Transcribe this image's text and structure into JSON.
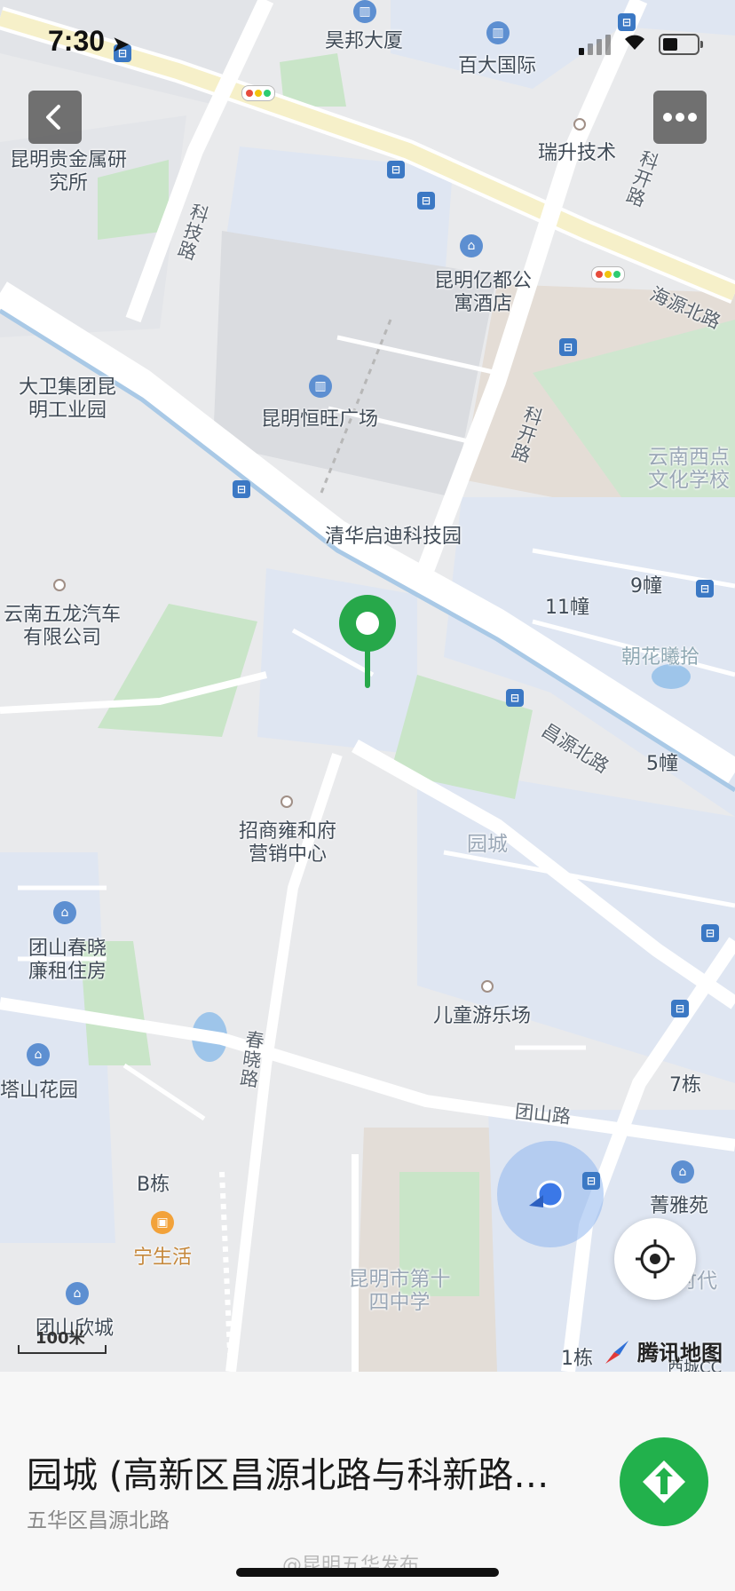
{
  "status_bar": {
    "time": "7:30"
  },
  "map": {
    "labels": {
      "haobang": "昊邦大厦",
      "baida": "百大国际",
      "ruisheng": "瑞升技术",
      "guijinshu": "昆明贵金属研究所",
      "kejilu": "科技路",
      "yidu": "昆明亿都公寓酒店",
      "kekailu_top": "科开路",
      "haiyuanbeilu": "海源北路",
      "dawei": "大卫集团昆明工业园",
      "hengwang": "昆明恒旺广场",
      "kekailu_mid": "科开路",
      "xidian": "云南西点文化学校",
      "qihua": "清华启迪科技园",
      "building9": "9幢",
      "building11": "11幢",
      "chaohua": "朝花曦拾",
      "wulong": "云南五龙汽车有限公司",
      "changyuan": "昌源北路",
      "building5": "5幢",
      "zhaoshang": "招商雍和府营销中心",
      "yuancheng": "园城",
      "tuanshan_lianzu": "团山春晓廉租住房",
      "ertong": "儿童游乐场",
      "tashan": "塔山花园",
      "chunxiaolu": "春晓路",
      "building7": "7栋",
      "tuanshanlu": "团山路",
      "b_building": "B栋",
      "jingya": "菁雅苑",
      "ningshenghuo": "宁生活",
      "no14": "昆明市第十四中学",
      "shidai": "时代",
      "tuanshan_xincheng": "团山欣城",
      "building1": "1栋",
      "xicheng": "西城CC"
    },
    "scale_label": "100米",
    "brand": "腾讯地图"
  },
  "panel": {
    "title": "园城 (高新区昌源北路与科新路…",
    "subtitle": "五华区昌源北路",
    "watermark": "@昆明五华发布"
  }
}
